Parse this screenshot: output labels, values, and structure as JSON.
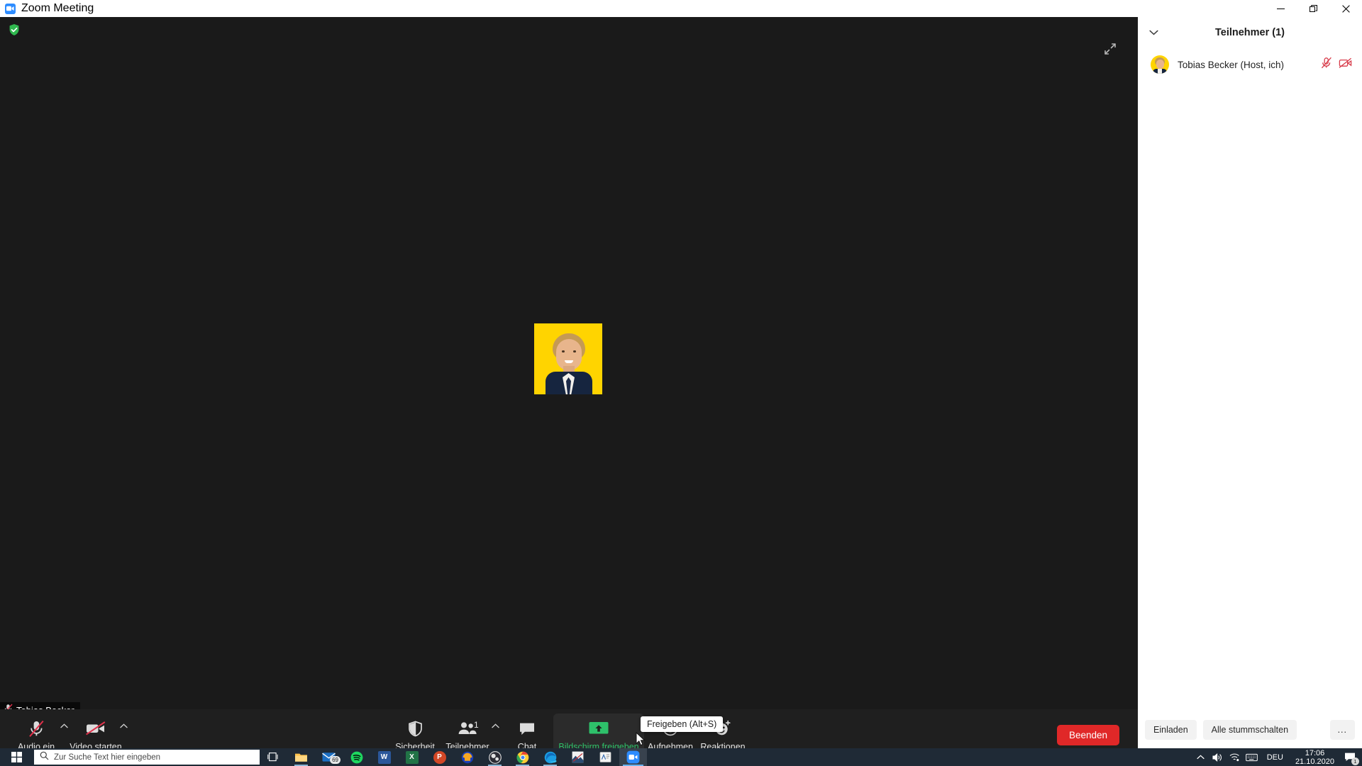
{
  "window": {
    "title": "Zoom Meeting",
    "logo_icon": "zoom-logo-icon",
    "controls": {
      "minimize": "minimize-icon",
      "restore": "restore-icon",
      "close": "close-icon"
    }
  },
  "stage": {
    "encryption_badge_icon": "green-shield-check-icon",
    "fullscreen_icon": "enter-fullscreen-icon",
    "self_name": "Tobias Becker",
    "self_muted_icon": "mic-muted-icon",
    "avatar_bg_color": "#FFD400"
  },
  "toolbar": {
    "audio": {
      "label": "Audio ein",
      "icon": "mic-muted-icon",
      "caret": "chevron-up-icon"
    },
    "video": {
      "label": "Video starten",
      "icon": "video-off-icon",
      "caret": "chevron-up-icon"
    },
    "security": {
      "label": "Sicherheit",
      "icon": "shield-icon"
    },
    "participants": {
      "label": "Teilnehmer",
      "icon": "people-icon",
      "count": "1",
      "caret": "chevron-up-icon"
    },
    "chat": {
      "label": "Chat",
      "icon": "chat-bubble-icon"
    },
    "share": {
      "label": "Bildschirm freigeben",
      "icon": "share-screen-icon",
      "accent_color": "#2ec06a"
    },
    "record": {
      "label": "Aufnehmen",
      "icon": "record-circle-icon"
    },
    "reactions": {
      "label": "Reaktionen",
      "icon": "smiley-plus-icon"
    },
    "end": {
      "label": "Beenden",
      "color": "#e02828"
    },
    "tooltip": "Freigeben (Alt+S)"
  },
  "participants_panel": {
    "collapse_icon": "chevron-down-icon",
    "title": "Teilnehmer (1)",
    "rows": [
      {
        "name": "Tobias Becker (Host, ich)",
        "avatar_icon": "user-avatar",
        "mic_icon": "mic-muted-red-icon",
        "video_icon": "video-off-red-icon"
      }
    ],
    "footer": {
      "invite": "Einladen",
      "mute_all": "Alle stummschalten",
      "more": "..."
    }
  },
  "taskbar": {
    "start_icon": "windows-start-icon",
    "search": {
      "placeholder": "Zur Suche Text hier eingeben",
      "icon": "search-icon"
    },
    "taskview_icon": "task-view-icon",
    "apps": [
      {
        "name": "file-explorer-icon",
        "label": ""
      },
      {
        "name": "mail-icon",
        "label": "",
        "badge": "69"
      },
      {
        "name": "spotify-icon",
        "label": ""
      },
      {
        "name": "word-icon",
        "label": "W"
      },
      {
        "name": "excel-icon",
        "label": "X"
      },
      {
        "name": "powerpoint-icon",
        "label": "P"
      },
      {
        "name": "audacity-icon",
        "label": ""
      },
      {
        "name": "obs-icon",
        "label": ""
      },
      {
        "name": "chrome-icon",
        "label": ""
      },
      {
        "name": "edge-icon",
        "label": ""
      },
      {
        "name": "photo-editor-icon",
        "label": ""
      },
      {
        "name": "document-app-icon",
        "label": ""
      },
      {
        "name": "zoom-app-icon",
        "label": ""
      }
    ],
    "tray": {
      "chevron": "chevron-up-icon",
      "volume": "speaker-icon",
      "wifi": "wifi-icon",
      "keyboard": "keyboard-icon",
      "language": "DEU",
      "time": "17:06",
      "date": "21.10.2020",
      "notifications_icon": "action-center-icon",
      "notifications_count": "1"
    }
  }
}
